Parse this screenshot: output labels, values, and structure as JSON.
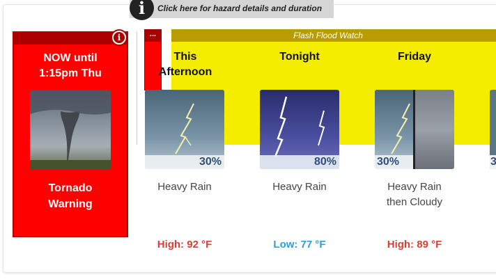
{
  "hazard": {
    "icon": "info-icon",
    "text": "Click here for hazard details and duration"
  },
  "warning": {
    "time_line1": "NOW until",
    "time_line2": "1:15pm Thu",
    "name_line1": "Tornado",
    "name_line2": "Warning",
    "color": "#ff0000"
  },
  "watch": {
    "label": "Flash Flood Watch",
    "more": "...",
    "color": "#f5ed00"
  },
  "periods": [
    {
      "name_line1": "This",
      "name_line2": "Afternoon",
      "pop": "30%",
      "short_line1": "Heavy Rain",
      "short_line2": "",
      "temp": "High: 92 °F",
      "temp_color": "#e03c31"
    },
    {
      "name_line1": "Tonight",
      "name_line2": "",
      "pop": "80%",
      "short_line1": "Heavy Rain",
      "short_line2": "",
      "temp": "Low: 77 °F",
      "temp_color": "#2b9fd8"
    },
    {
      "name_line1": "Friday",
      "name_line2": "",
      "pop": "30%",
      "short_line1": "Heavy Rain",
      "short_line2": "then Cloudy",
      "temp": "High: 89 °F",
      "temp_color": "#e03c31"
    }
  ],
  "partial_pop": "3"
}
